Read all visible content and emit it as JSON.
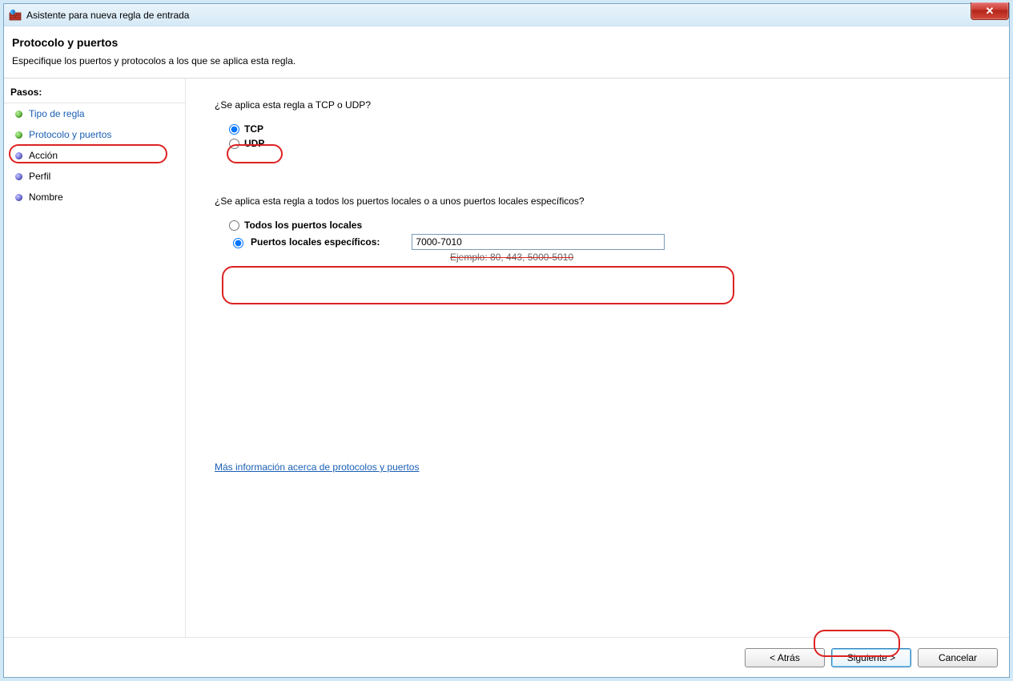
{
  "window": {
    "title": "Asistente para nueva regla de entrada",
    "close_glyph": "✕"
  },
  "header": {
    "title": "Protocolo y puertos",
    "subtitle": "Especifique los puertos y protocolos a los que se aplica esta regla."
  },
  "sidebar": {
    "title": "Pasos:",
    "steps": [
      {
        "label": "Tipo de regla",
        "bullet": "green",
        "link": true
      },
      {
        "label": "Protocolo y puertos",
        "bullet": "green",
        "link": true
      },
      {
        "label": "Acción",
        "bullet": "blue",
        "link": false
      },
      {
        "label": "Perfil",
        "bullet": "blue",
        "link": false
      },
      {
        "label": "Nombre",
        "bullet": "blue",
        "link": false
      }
    ]
  },
  "content": {
    "q1": "¿Se aplica esta regla a TCP o UDP?",
    "tcp_label": "TCP",
    "udp_label": "UDP",
    "q2": "¿Se aplica esta regla a todos los puertos locales o a unos puertos locales específicos?",
    "all_ports_label": "Todos los puertos locales",
    "specific_ports_label": "Puertos locales específicos:",
    "ports_value": "7000-7010",
    "example_label": "Ejemplo: 80, 443, 5000-5010",
    "more_link": "Más información acerca de protocolos y puertos"
  },
  "footer": {
    "back": "< Atrás",
    "next": "Siguiente >",
    "cancel": "Cancelar"
  }
}
